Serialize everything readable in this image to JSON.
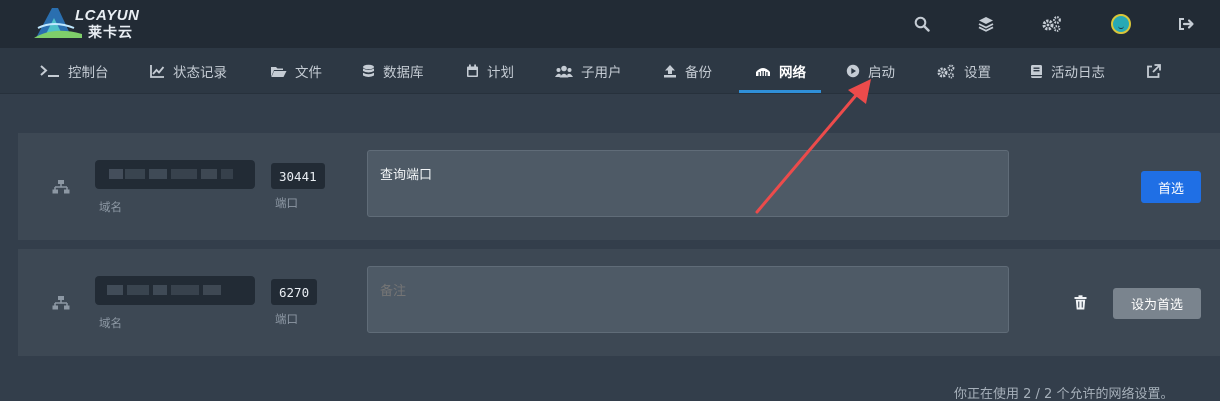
{
  "brand": {
    "name": "LCAYUN",
    "subtitle": "莱卡云"
  },
  "header_icons": [
    "search-icon",
    "layers-icon",
    "cogs-icon",
    "avatar",
    "logout-icon"
  ],
  "nav": {
    "items": [
      {
        "label": "控制台",
        "icon": "terminal-icon"
      },
      {
        "label": "状态记录",
        "icon": "chart-line-icon"
      },
      {
        "label": "文件",
        "icon": "folder-open-icon"
      },
      {
        "label": "数据库",
        "icon": "database-icon"
      },
      {
        "label": "计划",
        "icon": "calendar-icon"
      },
      {
        "label": "子用户",
        "icon": "users-icon"
      },
      {
        "label": "备份",
        "icon": "upload-icon"
      },
      {
        "label": "网络",
        "icon": "network-wired-icon",
        "active": true
      },
      {
        "label": "启动",
        "icon": "play-circle-icon"
      },
      {
        "label": "设置",
        "icon": "cogs-icon"
      },
      {
        "label": "活动日志",
        "icon": "book-icon"
      },
      {
        "label": "",
        "icon": "external-link-icon"
      }
    ]
  },
  "allocations": [
    {
      "domain_label": "域名",
      "port": "30441",
      "port_label": "端口",
      "notes_value": "查询端口",
      "button": "首选"
    },
    {
      "domain_label": "域名",
      "port": "6270",
      "port_label": "端口",
      "notes_placeholder": "备注",
      "button": "设为首选"
    }
  ],
  "usage_text": "你正在使用 2 / 2 个允许的网络设置。",
  "colors": {
    "header_bg": "#222b35",
    "nav_bg": "#2d3844",
    "page_bg": "#333e4b",
    "row_bg": "#3d4854",
    "primary_button": "#1f6fe5",
    "secondary_button": "#7a848e",
    "active_underline": "#2f8fd8",
    "annotation_arrow": "#ec4b4b"
  }
}
